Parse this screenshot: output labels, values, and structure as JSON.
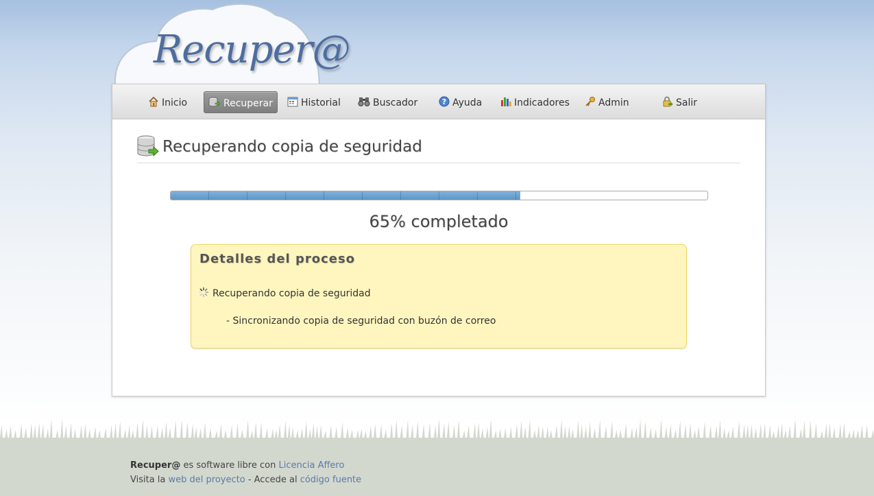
{
  "logo": {
    "text": "Recuper@"
  },
  "nav": {
    "items": [
      {
        "label": "Inicio",
        "icon": "home-icon"
      },
      {
        "label": "Recuperar",
        "icon": "database-restore-icon",
        "active": true
      },
      {
        "label": "Historial",
        "icon": "calendar-icon"
      },
      {
        "label": "Buscador",
        "icon": "binoculars-icon"
      },
      {
        "label": "Ayuda",
        "icon": "help-icon"
      },
      {
        "label": "Indicadores",
        "icon": "bar-chart-icon"
      },
      {
        "label": "Admin",
        "icon": "key-icon"
      },
      {
        "label": "Salir",
        "icon": "lock-exit-icon"
      }
    ]
  },
  "page": {
    "title": "Recuperando copia de seguridad",
    "title_icon": "database-restore-icon"
  },
  "progress": {
    "percent": 65,
    "text": "65% completado"
  },
  "details": {
    "title": "Detalles del proceso",
    "step": "Recuperando copia de seguridad",
    "step_icon": "spinner-icon",
    "substep": "- Sincronizando copia de seguridad con buzón de correo"
  },
  "footer": {
    "brand": "Recuper@",
    "line1_text": " es software libre con ",
    "license_link": "Licencia Affero",
    "line2_prefix": "Visita la ",
    "project_link": "web del proyecto",
    "line2_mid": " - Accede al ",
    "source_link": "código fuente"
  },
  "colors": {
    "active_nav": "#8a8a8a",
    "details_bg": "#fff6bf",
    "details_border": "#f0d75c",
    "progress_fill": "#a8cde7",
    "link": "#5a79a5",
    "footer_bg": "#d3d8cf"
  }
}
